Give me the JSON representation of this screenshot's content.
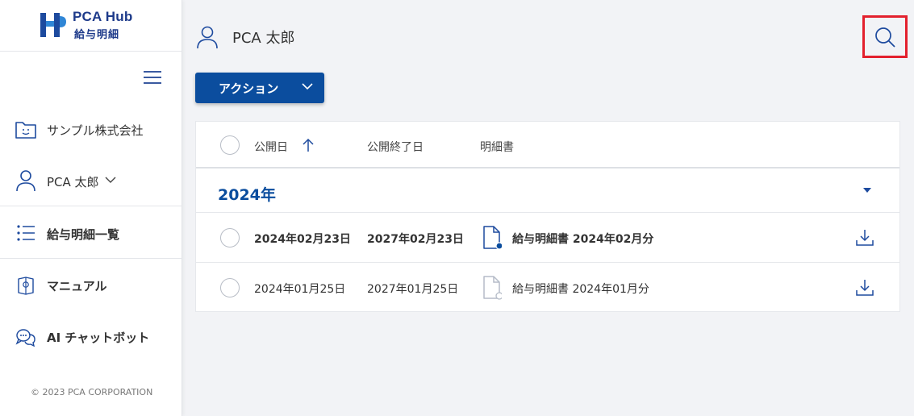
{
  "brand": {
    "name": "PCA Hub",
    "subtitle": "給与明細"
  },
  "sidebar": {
    "company": "サンプル株式会社",
    "user": "PCA 太郎",
    "items": [
      {
        "label": "給与明細一覧",
        "icon": "list-icon"
      },
      {
        "label": "マニュアル",
        "icon": "manual-icon"
      },
      {
        "label": "AI チャットボット",
        "icon": "chatbot-icon"
      }
    ],
    "copyright": "© 2023 PCA CORPORATION"
  },
  "header": {
    "user_name": "PCA 太郎"
  },
  "toolbar": {
    "action_label": "アクション"
  },
  "table": {
    "columns": [
      "公開日",
      "公開終了日",
      "明細書"
    ],
    "group_label": "2024年",
    "rows": [
      {
        "publish_date": "2024年02月23日",
        "end_date": "2027年02月23日",
        "document": "給与明細書 2024年02月分",
        "unread": true
      },
      {
        "publish_date": "2024年01月25日",
        "end_date": "2027年01月25日",
        "document": "給与明細書 2024年01月分",
        "unread": false
      }
    ]
  },
  "colors": {
    "accent": "#0b4d9e",
    "highlight": "#e3202d",
    "unread_dot": "#0b4d9e"
  }
}
